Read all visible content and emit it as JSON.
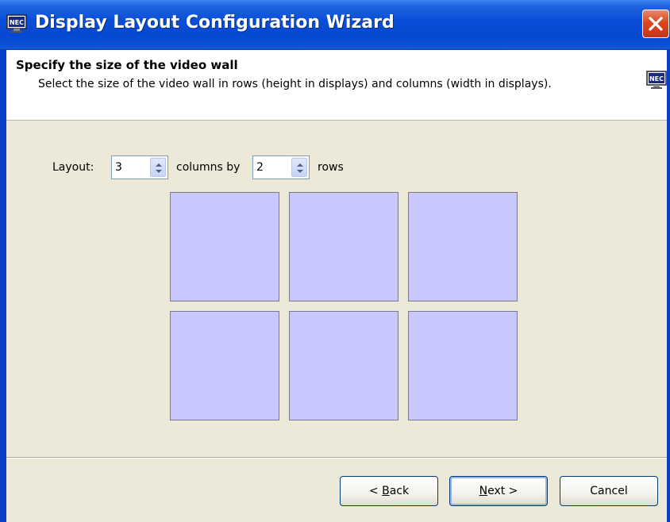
{
  "window": {
    "title": "Display Layout Configuration Wizard"
  },
  "header": {
    "title": "Specify the size of the video wall",
    "description": "Select the size of the video wall in rows (height in displays) and columns (width in displays)."
  },
  "layout": {
    "label": "Layout:",
    "columns_value": "3",
    "between_label": "columns by",
    "rows_value": "2",
    "rows_label": "rows"
  },
  "grid": {
    "columns": 3,
    "rows": 2,
    "tile_color": "#c8c8ff"
  },
  "buttons": {
    "back_prefix": "< ",
    "back_mnemonic": "B",
    "back_rest": "ack",
    "next_mnemonic": "N",
    "next_rest": "ext >",
    "cancel": "Cancel"
  },
  "icons": {
    "app": "nec-monitor-icon",
    "close": "close-icon"
  }
}
